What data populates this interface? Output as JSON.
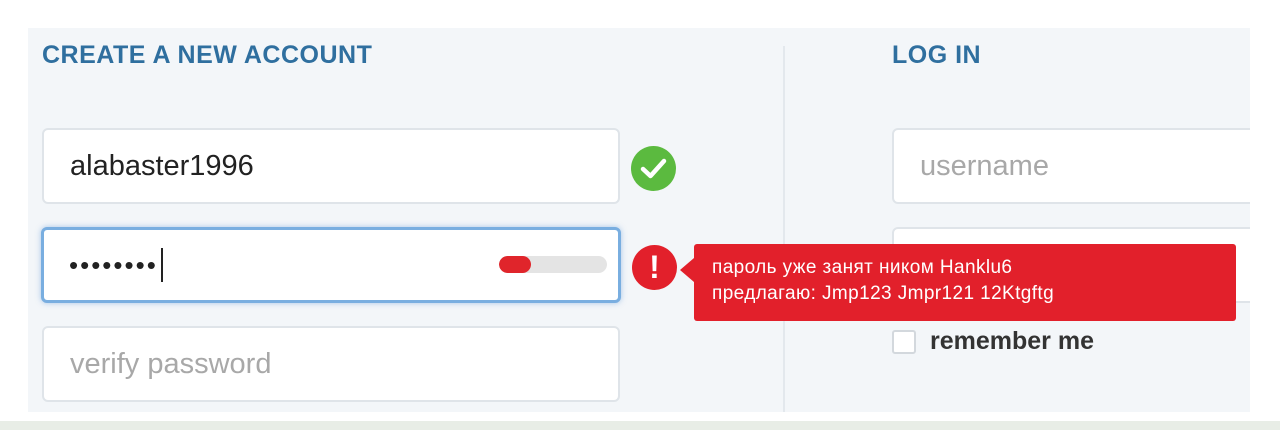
{
  "signup": {
    "heading": "CREATE A NEW ACCOUNT",
    "username_value": "alabaster1996",
    "password_masked": "••••••••",
    "password_strength": 0.3,
    "verify_placeholder": "verify password",
    "username_status_icon": "check-circle-icon",
    "password_status_icon": "exclamation-circle-icon",
    "error_line1": "пароль уже занят ником Hanklu6",
    "error_line2": "предлагаю: Jmp123 Jmpr121 12Ktgftg"
  },
  "login": {
    "heading": "LOG IN",
    "username_placeholder": "username",
    "remember_label": "remember me"
  },
  "colors": {
    "accent": "#2f6f9f",
    "success": "#5bba3f",
    "error": "#e2202b",
    "focus": "#79aee0"
  }
}
